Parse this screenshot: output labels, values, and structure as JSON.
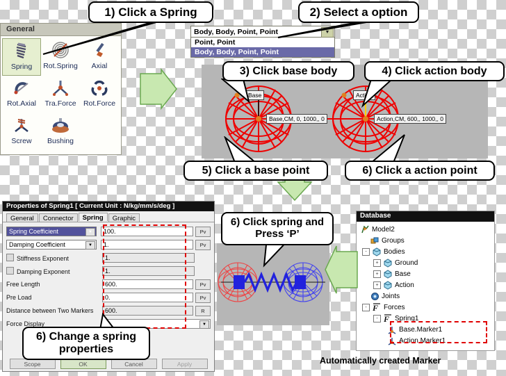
{
  "callouts": [
    {
      "id": "c1",
      "text": "1) Click a Spring"
    },
    {
      "id": "c2",
      "text": "2) Select a option"
    },
    {
      "id": "c3",
      "text": "3) Click base body"
    },
    {
      "id": "c4",
      "text": "4) Click action body"
    },
    {
      "id": "c5",
      "text": "5) Click a base point"
    },
    {
      "id": "c6",
      "text": "6) Click a action point"
    },
    {
      "id": "c7",
      "text": "6) Click spring and Press ‘P’"
    },
    {
      "id": "c8",
      "text": "6) Change a spring properties"
    }
  ],
  "toolbar": {
    "header": "General",
    "items": [
      {
        "label": "Spring",
        "icon": "spring-icon",
        "selected": true
      },
      {
        "label": "Rot.Spring",
        "icon": "rotary-spring-icon",
        "selected": false
      },
      {
        "label": "Axial",
        "icon": "axial-force-icon",
        "selected": false
      },
      {
        "label": "Rot.Axial",
        "icon": "rotational-axial-icon",
        "selected": false
      },
      {
        "label": "Tra.Force",
        "icon": "translational-force-icon",
        "selected": false
      },
      {
        "label": "Rot.Force",
        "icon": "rotational-force-icon",
        "selected": false
      },
      {
        "label": "Screw",
        "icon": "screw-icon",
        "selected": false
      },
      {
        "label": "Bushing",
        "icon": "bushing-icon",
        "selected": false
      }
    ]
  },
  "dropdown": {
    "value": "Body, Body, Point, Point",
    "options": [
      {
        "label": "Point, Point",
        "highlighted": false
      },
      {
        "label": "Body, Body, Point, Point",
        "highlighted": true
      }
    ]
  },
  "viewport": {
    "base_tag": "Base",
    "base_cm": "Base,CM, 0, 1000,, 0",
    "action_tag": "Action",
    "action_cm": "Action,CM, 600,, 1000,, 0"
  },
  "properties": {
    "title": "Properties of Spring1 [ Current Unit : N/kg/mm/s/deg ]",
    "tabs": [
      {
        "label": "General",
        "active": false
      },
      {
        "label": "Connector",
        "active": false
      },
      {
        "label": "Spring",
        "active": true
      },
      {
        "label": "Graphic",
        "active": false
      }
    ],
    "rows": [
      {
        "label": "Spring Coefficient",
        "type": "select",
        "selected": true,
        "value": "100.",
        "btn": "Pv"
      },
      {
        "label": "Damping Coefficient",
        "type": "select",
        "selected": false,
        "value": "1.",
        "btn": "Pv"
      },
      {
        "label": "Stiffness Exponent",
        "type": "check",
        "value": "1.",
        "btn": ""
      },
      {
        "label": "Damping Exponent",
        "type": "check",
        "value": "1.",
        "btn": ""
      },
      {
        "label": "Free Length",
        "type": "text",
        "value": "600.",
        "btn": "Pv"
      },
      {
        "label": "Pre Load",
        "type": "text",
        "value": "0.",
        "btn": "Pv"
      },
      {
        "label": "Distance between Two Markers",
        "type": "text",
        "value": "600.",
        "btn": "R"
      },
      {
        "label": "Force Display",
        "type": "combo",
        "value": "",
        "btn": ""
      }
    ],
    "buttons": [
      {
        "label": "Scope",
        "style": "plain"
      },
      {
        "label": "OK",
        "style": "ok"
      },
      {
        "label": "Cancel",
        "style": "plain"
      },
      {
        "label": "Apply",
        "style": "dim"
      }
    ]
  },
  "database": {
    "title": "Database",
    "caption": "Automatically created Marker",
    "tree": [
      {
        "label": "Model2",
        "depth": 0,
        "expander": "",
        "icon": "model-icon"
      },
      {
        "label": "Groups",
        "depth": 1,
        "expander": "",
        "icon": "groups-icon"
      },
      {
        "label": "Bodies",
        "depth": 1,
        "expander": "-",
        "icon": "bodies-icon"
      },
      {
        "label": "Ground",
        "depth": 2,
        "expander": "+",
        "icon": "body-icon"
      },
      {
        "label": "Base",
        "depth": 2,
        "expander": "+",
        "icon": "body-icon"
      },
      {
        "label": "Action",
        "depth": 2,
        "expander": "+",
        "icon": "body-icon"
      },
      {
        "label": "Joints",
        "depth": 1,
        "expander": "",
        "icon": "joints-icon"
      },
      {
        "label": "Forces",
        "depth": 1,
        "expander": "-",
        "icon": "force-icon"
      },
      {
        "label": "Spring1",
        "depth": 2,
        "expander": "-",
        "icon": "force-icon"
      },
      {
        "label": "Base.Marker1",
        "depth": 3,
        "expander": "",
        "icon": "marker-icon"
      },
      {
        "label": "Action.Marker1",
        "depth": 3,
        "expander": "",
        "icon": "marker-icon"
      }
    ]
  },
  "colors": {
    "highlight_blue": "#6a6aa8",
    "selection_green": "#e6efd0",
    "arrow_green": "#c8e8b0",
    "wheel_red": "#ee0000",
    "wheel_blue": "#2020dd",
    "dash_red": "#e00000"
  }
}
